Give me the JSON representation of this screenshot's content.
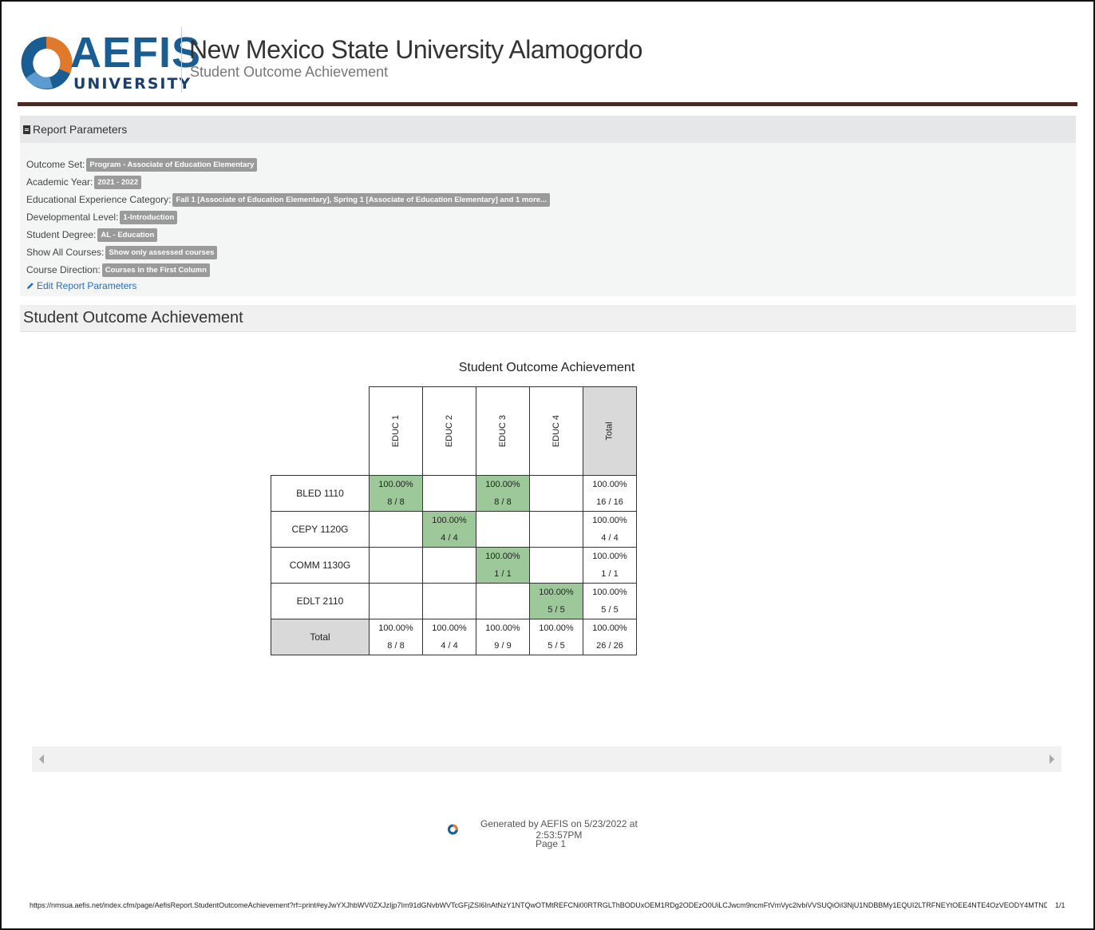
{
  "header": {
    "logo_word": "AEFIS",
    "logo_sub": "UNIVERSITY",
    "title": "New Mexico State University Alamogordo",
    "subtitle": "Student Outcome Achievement",
    "colors": {
      "brand_blue": "#1a5d93",
      "brand_orange": "#e07a2a",
      "bar": "#4a2a22"
    }
  },
  "params": {
    "heading": "Report Parameters",
    "rows": [
      {
        "label": "Outcome Set:",
        "value": "Program - Associate of Education Elementary"
      },
      {
        "label": "Academic Year:",
        "value": "2021 - 2022"
      },
      {
        "label": "Educational Experience Category:",
        "value": "Fall 1 [Associate of Education Elementary], Spring 1 [Associate of Education Elementary] and 1 more..."
      },
      {
        "label": "Developmental Level:",
        "value": "1-Introduction"
      },
      {
        "label": "Student Degree:",
        "value": "AL - Education"
      },
      {
        "label": "Show All Courses:",
        "value": "Show only assessed courses"
      },
      {
        "label": "Course Direction:",
        "value": "Courses in the First Column"
      }
    ],
    "edit_label": "Edit Report Parameters"
  },
  "section_title": "Student Outcome Achievement",
  "matrix": {
    "title": "Student Outcome Achievement",
    "columns": [
      "EDUC 1",
      "EDUC 2",
      "EDUC 3",
      "EDUC 4",
      "Total"
    ],
    "rows": [
      {
        "course": "BLED 1110",
        "cells": [
          {
            "pct": "100.00%",
            "frac": "8 / 8",
            "hit": true
          },
          {
            "pct": "",
            "frac": "",
            "hit": false
          },
          {
            "pct": "100.00%",
            "frac": "8 / 8",
            "hit": true
          },
          {
            "pct": "",
            "frac": "",
            "hit": false
          },
          {
            "pct": "100.00%",
            "frac": "16 / 16",
            "hit": false
          }
        ]
      },
      {
        "course": "CEPY 1120G",
        "cells": [
          {
            "pct": "",
            "frac": "",
            "hit": false
          },
          {
            "pct": "100.00%",
            "frac": "4 / 4",
            "hit": true
          },
          {
            "pct": "",
            "frac": "",
            "hit": false
          },
          {
            "pct": "",
            "frac": "",
            "hit": false
          },
          {
            "pct": "100.00%",
            "frac": "4 / 4",
            "hit": false
          }
        ]
      },
      {
        "course": "COMM 1130G",
        "cells": [
          {
            "pct": "",
            "frac": "",
            "hit": false
          },
          {
            "pct": "",
            "frac": "",
            "hit": false
          },
          {
            "pct": "100.00%",
            "frac": "1 / 1",
            "hit": true
          },
          {
            "pct": "",
            "frac": "",
            "hit": false
          },
          {
            "pct": "100.00%",
            "frac": "1 / 1",
            "hit": false
          }
        ]
      },
      {
        "course": "EDLT 2110",
        "cells": [
          {
            "pct": "",
            "frac": "",
            "hit": false
          },
          {
            "pct": "",
            "frac": "",
            "hit": false
          },
          {
            "pct": "",
            "frac": "",
            "hit": false
          },
          {
            "pct": "100.00%",
            "frac": "5 / 5",
            "hit": true
          },
          {
            "pct": "100.00%",
            "frac": "5 / 5",
            "hit": false
          }
        ]
      }
    ],
    "totals": {
      "label": "Total",
      "cells": [
        {
          "pct": "100.00%",
          "frac": "8 / 8"
        },
        {
          "pct": "100.00%",
          "frac": "4 / 4"
        },
        {
          "pct": "100.00%",
          "frac": "9 / 9"
        },
        {
          "pct": "100.00%",
          "frac": "5 / 5"
        },
        {
          "pct": "100.00%",
          "frac": "26 / 26"
        }
      ]
    },
    "colors": {
      "hit": "#9cc89a",
      "total_header": "#d9d9d9"
    }
  },
  "footer": {
    "generated": "Generated by AEFIS on 5/23/2022 at 2:53:57PM",
    "page": "Page 1",
    "url": "https://nmsua.aefis.net/index.cfm/page/AefisReport.StudentOutcomeAchievement?rf=print#eyJwYXJhbWV0ZXJzIjp7Im91dGNvbWVTcGFjZSI6InAtNzY1NTQwOTMtREFCNi00RTRGLThBODUxOEM1RDg2ODEzO0UiLCJwcm9ncmFtVmVyc2lvbiVVSUQiOiI3NjU1NDBBMy1EQUI2LTRFNEYtOEE4NTE4OzVEODY4MTNDR...",
    "page_count": "1/1"
  }
}
